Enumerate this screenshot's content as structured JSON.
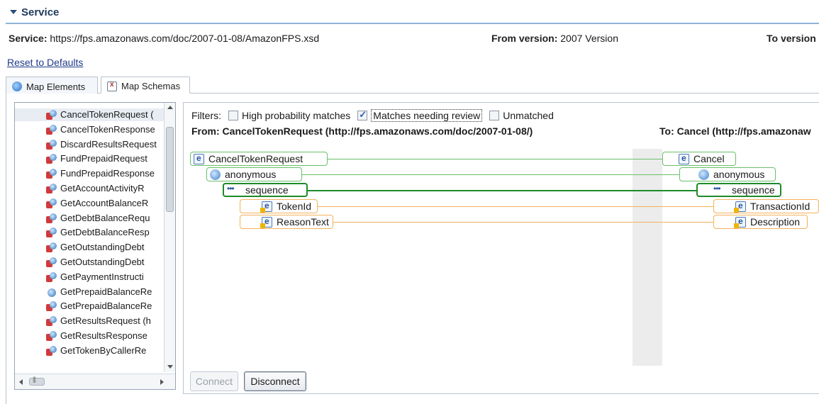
{
  "section": {
    "title": "Service"
  },
  "info": {
    "service_label": "Service:",
    "service_value": "https://fps.amazonaws.com/doc/2007-01-08/AmazonFPS.xsd",
    "from_version_label": "From version:",
    "from_version_value": "2007 Version",
    "to_version_label": "To version"
  },
  "reset_link": "Reset to Defaults",
  "tabs": [
    {
      "label": "Map Elements",
      "icon": "element-icon"
    },
    {
      "label": "Map Schemas",
      "icon": "xsd-schema-icon"
    }
  ],
  "elements_list": [
    {
      "label": "CancelTokenRequest (",
      "icon": "message-part-icon",
      "selected": true
    },
    {
      "label": "CancelTokenResponse",
      "icon": "message-part-icon"
    },
    {
      "label": "DiscardResultsRequest",
      "icon": "message-part-icon"
    },
    {
      "label": "FundPrepaidRequest",
      "icon": "message-part-icon"
    },
    {
      "label": "FundPrepaidResponse",
      "icon": "message-part-icon"
    },
    {
      "label": "GetAccountActivityR",
      "icon": "message-part-icon"
    },
    {
      "label": "GetAccountBalanceR",
      "icon": "message-part-icon"
    },
    {
      "label": "GetDebtBalanceRequ",
      "icon": "message-part-icon"
    },
    {
      "label": "GetDebtBalanceResp",
      "icon": "message-part-icon"
    },
    {
      "label": "GetOutstandingDebt",
      "icon": "message-part-icon"
    },
    {
      "label": "GetOutstandingDebt",
      "icon": "message-part-icon"
    },
    {
      "label": "GetPaymentInstructi",
      "icon": "message-part-icon"
    },
    {
      "label": "GetPrepaidBalanceRe",
      "icon": "element-icon"
    },
    {
      "label": "GetPrepaidBalanceRe",
      "icon": "message-part-icon"
    },
    {
      "label": "GetResultsRequest (h",
      "icon": "message-part-icon"
    },
    {
      "label": "GetResultsResponse",
      "icon": "message-part-icon"
    },
    {
      "label": "GetTokenByCallerRe",
      "icon": "message-part-icon"
    }
  ],
  "filters": {
    "label": "Filters:",
    "options": [
      {
        "label": "High probability matches",
        "checked": false
      },
      {
        "label": "Matches needing review",
        "checked": true
      },
      {
        "label": "Unmatched",
        "checked": false
      }
    ]
  },
  "from_header": "From: CancelTokenRequest (http://fps.amazonaws.com/doc/2007-01-08/)",
  "to_header": "To: Cancel (http://fps.amazonaw",
  "from_tree": [
    {
      "label": "CancelTokenRequest",
      "kind": "element"
    },
    {
      "label": "anonymous",
      "kind": "anonymous-type"
    },
    {
      "label": "sequence",
      "kind": "sequence"
    },
    {
      "label": "TokenId",
      "kind": "element-attribute"
    },
    {
      "label": "ReasonText",
      "kind": "element-attribute"
    }
  ],
  "to_tree": [
    {
      "label": "Cancel",
      "kind": "element"
    },
    {
      "label": "anonymous",
      "kind": "anonymous-type"
    },
    {
      "label": "sequence",
      "kind": "sequence"
    },
    {
      "label": "TransactionId",
      "kind": "element-attribute"
    },
    {
      "label": "Description",
      "kind": "element-attribute"
    }
  ],
  "buttons": {
    "connect": "Connect",
    "disconnect": "Disconnect"
  },
  "colors": {
    "match": "#6bbf6b",
    "selected_match": "#1e8a2a",
    "review": "#f2b25a",
    "accent": "#2b56a0"
  }
}
